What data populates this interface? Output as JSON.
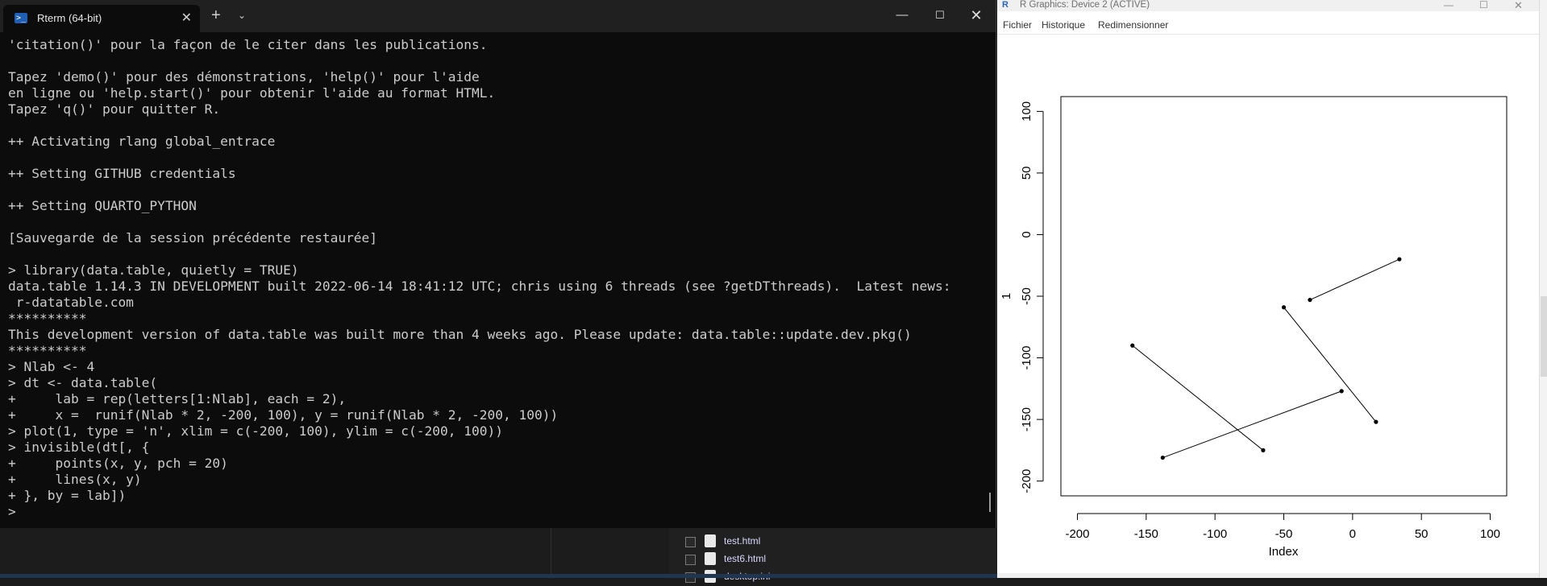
{
  "terminal": {
    "tab_title": "Rterm (64-bit)",
    "tab_icon": "powershell-icon",
    "close_tab": "✕",
    "new_tab": "+",
    "dropdown": "⌄",
    "minimize": "—",
    "maximize": "☐",
    "close": "✕",
    "lines": [
      "'citation()' pour la façon de le citer dans les publications.",
      "",
      "Tapez 'demo()' pour des démonstrations, 'help()' pour l'aide",
      "en ligne ou 'help.start()' pour obtenir l'aide au format HTML.",
      "Tapez 'q()' pour quitter R.",
      "",
      "++ Activating rlang global_entrace",
      "",
      "++ Setting GITHUB credentials",
      "",
      "++ Setting QUARTO_PYTHON",
      "",
      "[Sauvegarde de la session précédente restaurée]",
      "",
      "> library(data.table, quietly = TRUE)",
      "data.table 1.14.3 IN DEVELOPMENT built 2022-06-14 18:41:12 UTC; chris using 6 threads (see ?getDTthreads).  Latest news:",
      " r-datatable.com",
      "**********",
      "This development version of data.table was built more than 4 weeks ago. Please update: data.table::update.dev.pkg()",
      "**********",
      "> Nlab <- 4",
      "> dt <- data.table(",
      "+     lab = rep(letters[1:Nlab], each = 2),",
      "+     x =  runif(Nlab * 2, -200, 100), y = runif(Nlab * 2, -200, 100))",
      "> plot(1, type = 'n', xlim = c(-200, 100), ylim = c(-200, 100))",
      "> invisible(dt[, {",
      "+     points(x, y, pch = 20)",
      "+     lines(x, y)",
      "+ }, by = lab])",
      "> "
    ]
  },
  "explorer": {
    "files": [
      "test.html",
      "test6.html",
      "desktop.ini"
    ]
  },
  "graphics_window": {
    "title": "R Graphics: Device 2 (ACTIVE)",
    "menu": [
      "Fichier",
      "Historique",
      "Redimensionner"
    ],
    "minimize": "—",
    "maximize": "☐",
    "close": "✕"
  },
  "chart_data": {
    "type": "scatter",
    "title": "",
    "xlabel": "Index",
    "ylabel": "1",
    "xlim": [
      -200,
      100
    ],
    "ylim": [
      -200,
      100
    ],
    "xticks": [
      -200,
      -150,
      -100,
      -50,
      0,
      50,
      100
    ],
    "yticks": [
      -200,
      -150,
      -100,
      -50,
      0,
      50,
      100
    ],
    "grid": false,
    "series": [
      {
        "points": [
          [
            -160,
            -90
          ],
          [
            -65,
            -175
          ]
        ]
      },
      {
        "points": [
          [
            -138,
            -181
          ],
          [
            -8,
            -127
          ]
        ]
      },
      {
        "points": [
          [
            -50,
            -59
          ],
          [
            17,
            -152
          ]
        ]
      },
      {
        "points": [
          [
            -31,
            -53
          ],
          [
            34,
            -20
          ]
        ]
      }
    ]
  }
}
